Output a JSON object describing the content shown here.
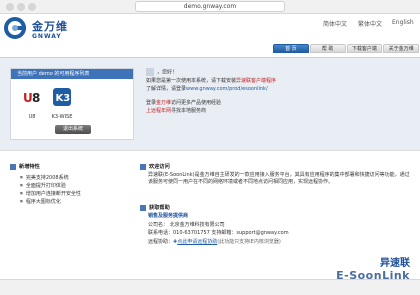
{
  "browser": {
    "url": "demo.gnway.com"
  },
  "header": {
    "logo_cn": "金万维",
    "logo_en": "GNWAY",
    "lang": [
      "简体中文",
      "繁体中文",
      "English"
    ],
    "nav": [
      "首 页",
      "帮 助",
      "下载客户端",
      "关于金万维"
    ],
    "colors": {
      "accent": "#1e5ca3",
      "brand": "#1e4f9a"
    }
  },
  "left_panel": {
    "title": "当前用户 demo 的可用程序列表",
    "apps": [
      {
        "label": "U8",
        "icon": "u8-icon"
      },
      {
        "label": "K3-WISE",
        "icon": "k3-icon"
      }
    ],
    "logout": "退出系统"
  },
  "welcome": {
    "greeting": "，您好！",
    "line1": "如果您是第一次使用本系统，请下载安装",
    "link1": "异速联客户端程序",
    "line2": "了解详情，请登录",
    "link2": "www.gnway.com/prod/esoonlink/",
    "line3": "登录",
    "link3": "金万维",
    "line3b": "访问更多产品使用经验",
    "line4": "上远程年网",
    "line4b": "寻找本地服务商"
  },
  "features": {
    "title": "新增特性",
    "items": [
      "完美支持2008系统",
      "全面提升打印体验",
      "增加用户连接断开安全性",
      "程序大图标优化"
    ]
  },
  "welcome_access": {
    "title": "欢迎访问",
    "text": "异速联(E-SoonLink)是金万维自主研发的一款应用接入服务平台，其具有应用程序的集中部署和快捷访问等功能，通过该服务可使同一用户在不同的网络环境或者不同地点访问相同应用，实现远程协作。"
  },
  "support": {
    "title": "获取帮助",
    "subtitle": "销售及服务提供商",
    "company": "公司名：  北京金万维科技有限公司",
    "contact": "联系电话：010-63701757   支持邮箱：support@gnway.com",
    "remote": "远程协助：",
    "remote_link": "点此申请远程协助",
    "remote_note": "(此功能只支持IE内核浏览器)"
  },
  "brand": {
    "cn": "异速联",
    "en": "E-SoonLink"
  }
}
